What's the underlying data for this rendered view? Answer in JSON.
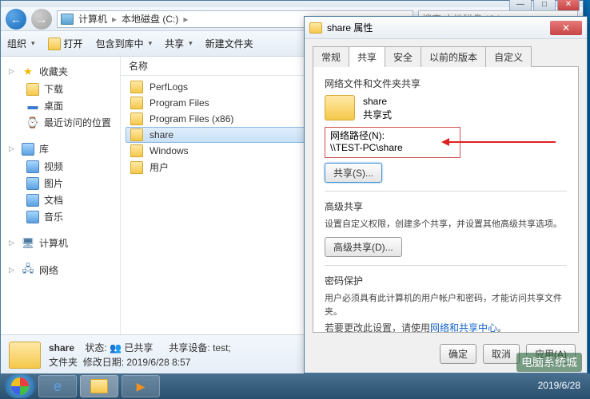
{
  "nav": {
    "crumbs": [
      "计算机",
      "本地磁盘 (C:)"
    ],
    "search_placeholder": "搜索 本地磁盘 (C:)"
  },
  "toolbar": {
    "organize": "组织",
    "open": "打开",
    "include": "包含到库中",
    "share": "共享",
    "newfolder": "新建文件夹"
  },
  "sidebar": {
    "fav": {
      "label": "收藏夹",
      "items": [
        "下载",
        "桌面",
        "最近访问的位置"
      ]
    },
    "lib": {
      "label": "库",
      "items": [
        "视频",
        "图片",
        "文档",
        "音乐"
      ]
    },
    "comp": {
      "label": "计算机"
    },
    "net": {
      "label": "网络"
    }
  },
  "files": {
    "col_name": "名称",
    "items": [
      "PerfLogs",
      "Program Files",
      "Program Files (x86)",
      "share",
      "Windows",
      "用户"
    ]
  },
  "status": {
    "name": "share",
    "type_label": "文件夹",
    "state_label": "状态:",
    "state_value": "已共享",
    "mod_label": "修改日期:",
    "mod_value": "2019/6/28 8:57",
    "sharedev_label": "共享设备:",
    "sharedev_value": "test;"
  },
  "dialog": {
    "title": "share 属性",
    "tabs": [
      "常规",
      "共享",
      "安全",
      "以前的版本",
      "自定义"
    ],
    "active_tab": 1,
    "section1": "网络文件和文件夹共享",
    "folder_name": "share",
    "folder_state": "共享式",
    "path_label": "网络路径(N):",
    "path_value": "\\\\TEST-PC\\share",
    "share_btn": "共享(S)...",
    "section2": "高级共享",
    "adv_desc": "设置自定义权限，创建多个共享，并设置其他高级共享选项。",
    "adv_btn": "高级共享(D)...",
    "section3": "密码保护",
    "pwd_desc": "用户必须具有此计算机的用户帐户和密码，才能访问共享文件夹。",
    "pwd_change": "若要更改此设置，请使用",
    "pwd_link": "网络和共享中心",
    "ok": "确定",
    "cancel": "取消",
    "apply": "应用(A)"
  },
  "taskbar": {
    "date": "2019/6/28"
  },
  "watermark": "电脑系统城"
}
